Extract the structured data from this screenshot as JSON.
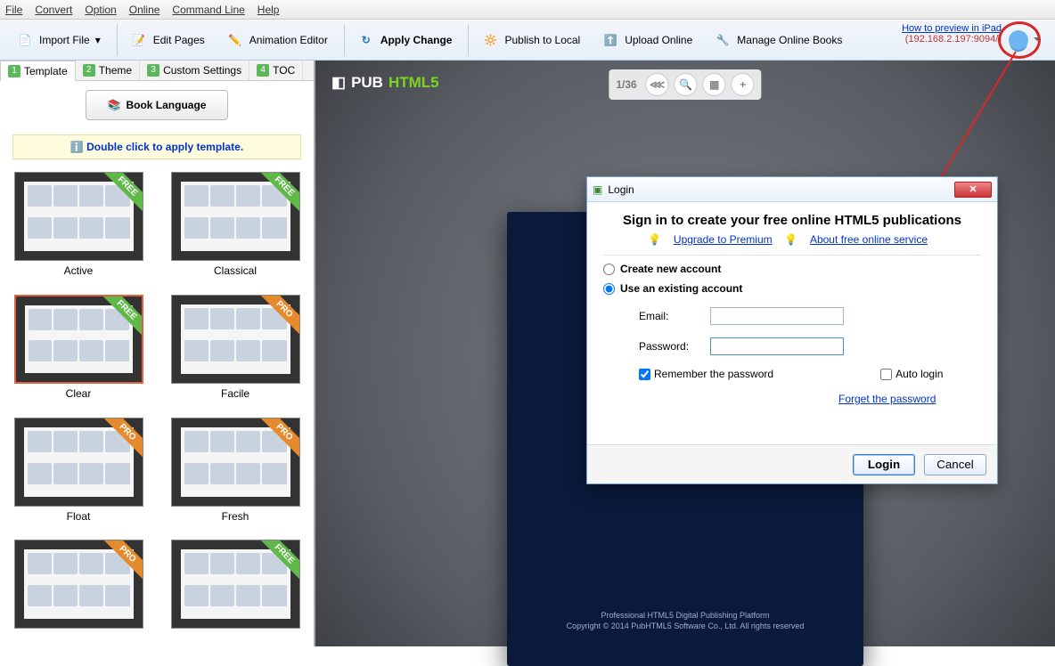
{
  "menubar": [
    "File",
    "Convert",
    "Option",
    "Online",
    "Command Line",
    "Help"
  ],
  "toolbar": {
    "import": "Import File",
    "edit_pages": "Edit Pages",
    "animation": "Animation Editor",
    "apply_change": "Apply Change",
    "publish_local": "Publish to Local",
    "upload_online": "Upload Online",
    "manage_books": "Manage Online Books",
    "preview_link": "How to preview in iPad",
    "ip_addr": "(192.168.2.197:9094/)"
  },
  "tabs": [
    {
      "num": "1",
      "label": "Template"
    },
    {
      "num": "2",
      "label": "Theme"
    },
    {
      "num": "3",
      "label": "Custom Settings"
    },
    {
      "num": "4",
      "label": "TOC"
    }
  ],
  "book_language": "Book Language",
  "hint": "Double click to apply template.",
  "templates": [
    {
      "name": "Active",
      "ribbon": "FREE"
    },
    {
      "name": "Classical",
      "ribbon": "FREE"
    },
    {
      "name": "Clear",
      "ribbon": "FREE",
      "selected": true
    },
    {
      "name": "Facile",
      "ribbon": "PRO"
    },
    {
      "name": "Float",
      "ribbon": "PRO"
    },
    {
      "name": "Fresh",
      "ribbon": "PRO"
    },
    {
      "name": "",
      "ribbon": "PRO"
    },
    {
      "name": "",
      "ribbon": "FREE"
    }
  ],
  "preview": {
    "logo_a": "PUB",
    "logo_b": "HTML5",
    "page_counter": "1/36",
    "footer_l1": "Professional HTML5 Digital Publishing Platform",
    "footer_l2": "Copyright © 2014 PubHTML5 Software Co., Ltd. All rights reserved"
  },
  "dialog": {
    "title": "Login",
    "heading": "Sign in to create your free online HTML5 publications",
    "upgrade": "Upgrade to Premium",
    "about": "About free online service",
    "create_new": "Create new account",
    "use_existing": "Use an existing account",
    "email_label": "Email:",
    "password_label": "Password:",
    "remember": "Remember the password",
    "autologin": "Auto login",
    "forgot": "Forget the password",
    "login_btn": "Login",
    "cancel_btn": "Cancel"
  }
}
